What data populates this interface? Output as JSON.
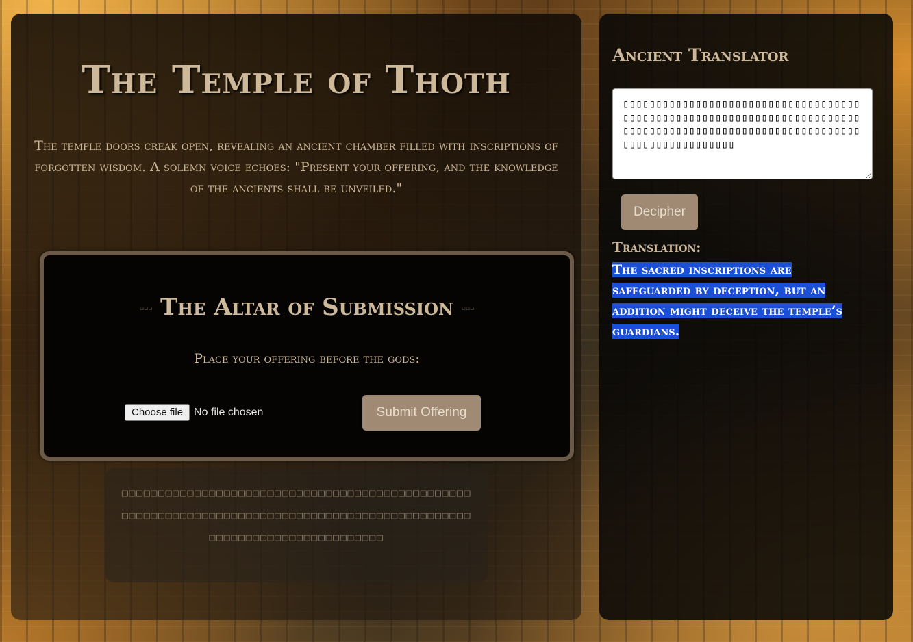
{
  "main": {
    "title": "The Temple of Thoth",
    "intro": "The temple doors creak open, revealing an ancient chamber filled with inscriptions of forgotten wisdom. A solemn voice echoes: \"Present your offering, and the knowledge of the ancients shall be unveiled.\"",
    "altar": {
      "title": "The Altar of Submission",
      "ornament": "▫▫▫",
      "prompt": "Place your offering before the gods:",
      "file_button_label": "Choose file",
      "file_status": "No file chosen",
      "submit_label": "Submit Offering"
    },
    "hieroglyph_box": "□□□□□□□□□□□□□□□□□□□□□□□□□□□□□□□□□□□□□□□□□□□□□□□□□□□□□□□□□□□□□□□□□□□□□□□□□□□□□□□□□□□□□□□□□□□□□□□□□□□□□□□□□□□□□□□□□□□□□□□□"
  },
  "translator": {
    "title": "Ancient Translator",
    "input_value": "▯▯▯▯▯▯▯▯▯▯▯▯▯▯▯▯▯▯▯▯▯▯▯▯▯▯▯▯▯▯▯▯▯▯▯▯▯▯▯▯▯▯▯▯▯▯▯▯▯▯▯▯▯▯▯▯▯▯▯▯▯▯▯▯▯▯▯▯▯▯▯▯▯▯▯▯▯▯▯▯▯▯▯▯▯▯▯▯▯▯▯▯▯▯▯▯▯▯▯▯▯▯▯▯▯▯▯▯▯▯▯▯▯▯▯▯▯▯▯▯▯▯▯▯▯",
    "decipher_label": "Decipher",
    "translation_label": "Translation:",
    "translation_text": "The sacred inscriptions are safeguarded by deception, but an addition might deceive the temple’s guardians."
  }
}
